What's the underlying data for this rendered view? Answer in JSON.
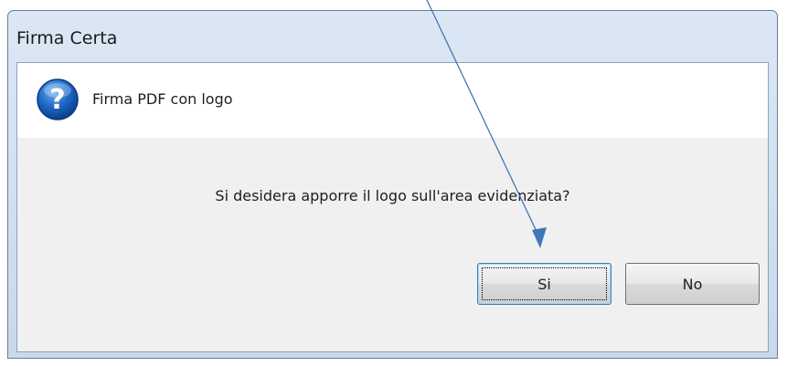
{
  "window": {
    "title": "Firma Certa"
  },
  "dialog": {
    "icon": "question-icon",
    "header": "Firma PDF con logo",
    "message": "Si desidera apporre il logo sull'area evidenziata?",
    "buttons": {
      "yes_label": "Si",
      "no_label": "No"
    }
  },
  "annotation": {
    "type": "arrow",
    "color": "#3f78b7"
  }
}
